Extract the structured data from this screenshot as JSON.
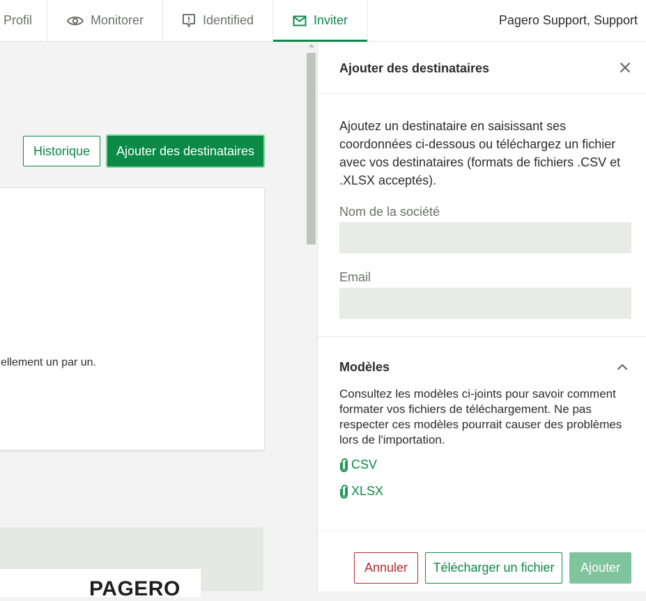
{
  "nav": {
    "tabs": [
      {
        "label": "Profil",
        "icon": "profile-icon"
      },
      {
        "label": "Monitorer",
        "icon": "eye-icon"
      },
      {
        "label": "Identified",
        "icon": "alert-message-icon"
      },
      {
        "label": "Inviter",
        "icon": "mail-icon",
        "active": true
      }
    ],
    "user": "Pagero Support, Support"
  },
  "main": {
    "history_button": "Historique",
    "add_recipients_button": "Ajouter des destinataires",
    "card_text": "ellement un par un.",
    "logo_text": "PAGERO"
  },
  "drawer": {
    "title": "Ajouter des destinataires",
    "intro": "Ajoutez un destinataire en saisissant ses coordonnées ci-dessous ou téléchargez un fichier avec vos destinataires (formats de fichiers .CSV et .XLSX acceptés).",
    "company_label": "Nom de la société",
    "company_value": "",
    "email_label": "Email",
    "email_value": "",
    "templates": {
      "title": "Modèles",
      "description": "Consultez les modèles ci-joints pour savoir comment formater vos fichiers de téléchargement. Ne pas respecter ces modèles pourrait causer des problèmes lors de l'importation.",
      "files": [
        "CSV",
        "XLSX"
      ]
    },
    "footer": {
      "cancel": "Annuler",
      "upload": "Télécharger un fichier",
      "add": "Ajouter"
    }
  },
  "colors": {
    "brand_green": "#0a8a45",
    "disabled_green": "#7fc49d",
    "danger_red": "#b32b2b"
  }
}
